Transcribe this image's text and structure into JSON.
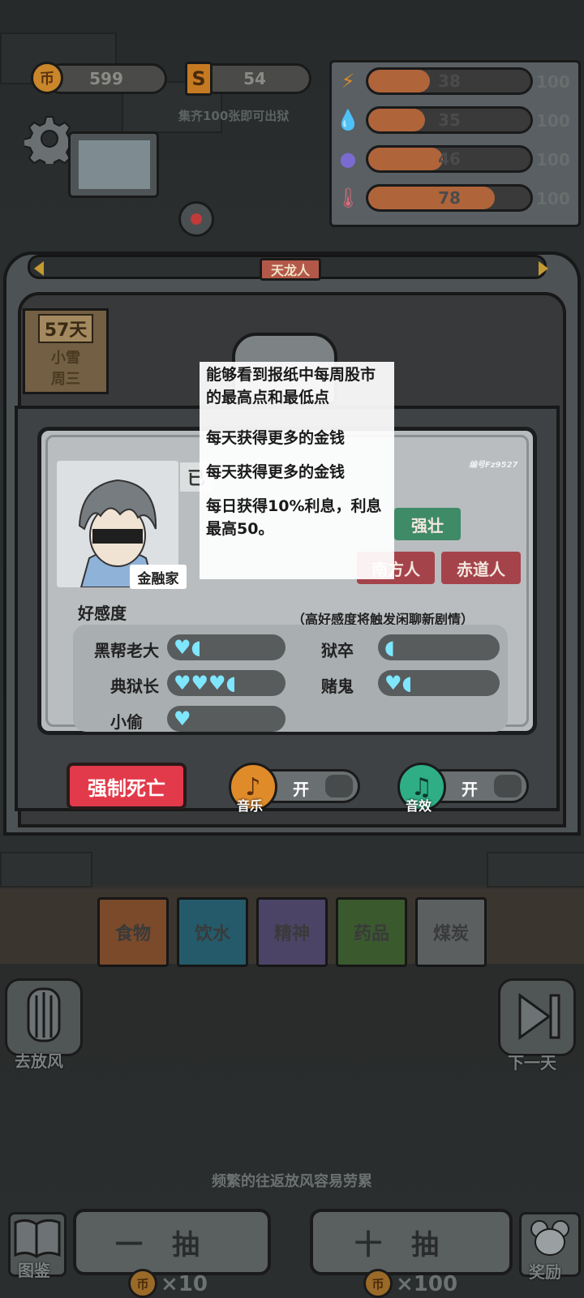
{
  "hud": {
    "coins": "599",
    "tickets": "54",
    "ticket_hint": "集齐100张即可出狱",
    "coin_glyph": "币",
    "ticket_glyph": "S"
  },
  "stats": [
    {
      "name": "energy",
      "icon": "lightning-icon",
      "value": "38",
      "max": "100",
      "fraction": 0.38
    },
    {
      "name": "water",
      "icon": "water-drop-icon",
      "value": "35",
      "max": "100",
      "fraction": 0.35
    },
    {
      "name": "mind",
      "icon": "brain-icon",
      "value": "46",
      "max": "100",
      "fraction": 0.46
    },
    {
      "name": "temperature",
      "icon": "thermometer-icon",
      "value": "78",
      "max": "100",
      "fraction": 0.78
    }
  ],
  "header": {
    "title_tag": "天龙人"
  },
  "calendar": {
    "day": "57天",
    "weather": "小雪",
    "weekday": "周三"
  },
  "character": {
    "serial": "编号Fz9527",
    "role_label": "金融家",
    "status_partial": "已",
    "traits_row1": [
      "强壮"
    ],
    "traits_row2": [
      "南方人",
      "赤道人"
    ]
  },
  "tooltip": {
    "lines": [
      "能够看到报纸中每周股市的最高点和最低点",
      "每天获得更多的金钱",
      "每天获得更多的金钱",
      "每日获得10%利息，利息最高50。"
    ]
  },
  "affinity": {
    "title": "好感度",
    "note": "（高好感度将触发闲聊新剧情）",
    "items": [
      {
        "name": "黑帮老大",
        "hearts": "♥◖"
      },
      {
        "name": "狱卒",
        "hearts": "◖"
      },
      {
        "name": "典狱长",
        "hearts": "♥♥♥◖"
      },
      {
        "name": "赌鬼",
        "hearts": "♥◖"
      },
      {
        "name": "小偷",
        "hearts": "♥"
      }
    ]
  },
  "settings": {
    "force_death": "强制死亡",
    "music_label": "音乐",
    "music_state": "开",
    "sfx_label": "音效",
    "sfx_state": "开"
  },
  "inventory": [
    {
      "label": "食物",
      "color": "#9a4a22"
    },
    {
      "label": "饮水",
      "color": "#1f6f86"
    },
    {
      "label": "精神",
      "color": "#5b4a86"
    },
    {
      "label": "药品",
      "color": "#3f7a2c"
    },
    {
      "label": "煤炭",
      "color": "#6a6f71"
    }
  ],
  "nav": {
    "go_out": "去放风",
    "next_day": "下一天",
    "hint": "频繁的往返放风容易劳累",
    "codex": "图鉴",
    "reward": "奖励"
  },
  "draws": {
    "one": "一抽",
    "one_cost": "×10",
    "ten": "十抽",
    "ten_cost": "×100"
  },
  "colors": {
    "danger": "#e23a4a",
    "trait_green": "#3f8a67",
    "trait_red": "#a5434b",
    "heart": "#7fe6ff",
    "music_orange": "#e08b2a",
    "sfx_green": "#2fae86"
  }
}
